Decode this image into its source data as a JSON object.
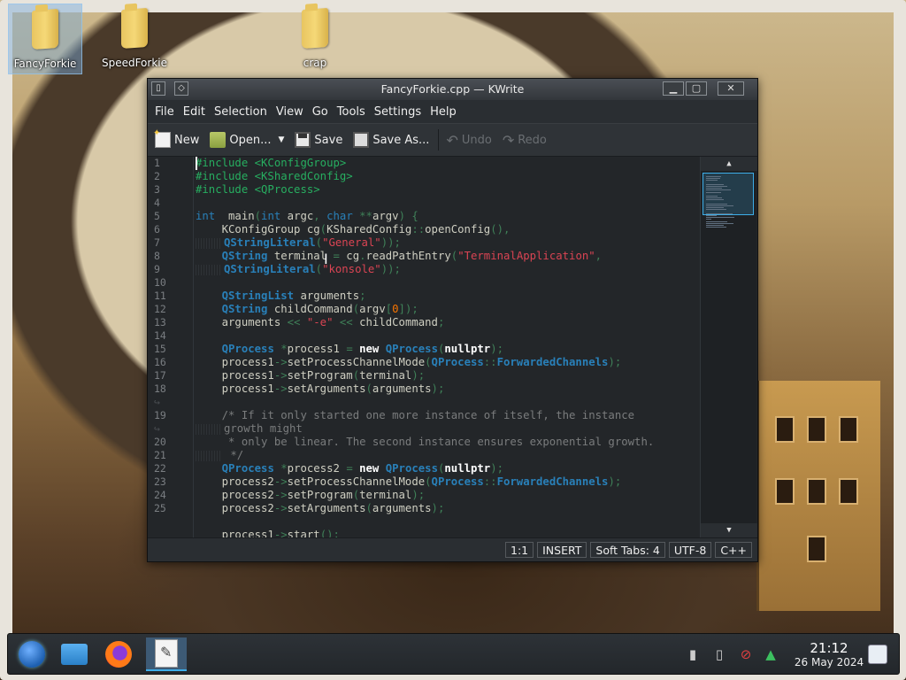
{
  "desktop": {
    "icons": [
      {
        "label": "FancyForkie"
      },
      {
        "label": "SpeedForkie"
      },
      {
        "label": "crap"
      }
    ]
  },
  "window": {
    "title": "FancyForkie.cpp — KWrite",
    "menu": [
      "File",
      "Edit",
      "Selection",
      "View",
      "Go",
      "Tools",
      "Settings",
      "Help"
    ],
    "toolbar": {
      "new": "New",
      "open": "Open...",
      "save": "Save",
      "save_as": "Save As...",
      "undo": "Undo",
      "redo": "Redo"
    },
    "gutter": [
      "1",
      "2",
      "3",
      "4",
      "5",
      "6",
      "7",
      "8",
      "9",
      "10",
      "11",
      "12",
      "13",
      "14",
      "15",
      "16",
      "17",
      "18",
      "↪",
      "19",
      "↪",
      "20",
      "21",
      "22",
      "23",
      "24",
      "25"
    ],
    "status": {
      "position": "1:1",
      "mode": "INSERT",
      "tabs": "Soft Tabs: 4",
      "encoding": "UTF-8",
      "language": "C++"
    }
  },
  "taskbar": {
    "time": "21:12",
    "date": "26 May 2024"
  },
  "colors": {
    "editor_bg": "#232629",
    "keyword": "#2980b9",
    "string": "#da4453",
    "preprocessor": "#27ae60",
    "comment": "#7a7c7d",
    "accent": "#3daee9"
  }
}
